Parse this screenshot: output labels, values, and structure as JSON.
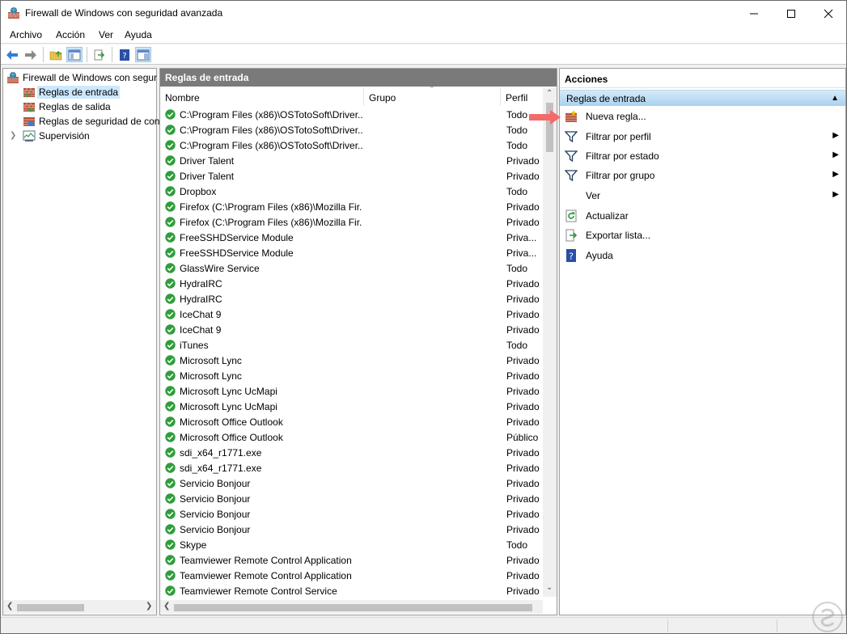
{
  "window": {
    "title": "Firewall de Windows con seguridad avanzada"
  },
  "menu": [
    "Archivo",
    "Acción",
    "Ver",
    "Ayuda"
  ],
  "tree": {
    "root": "Firewall de Windows con segur",
    "items": [
      "Reglas de entrada",
      "Reglas de salida",
      "Reglas de seguridad de con",
      "Supervisión"
    ]
  },
  "center": {
    "header": "Reglas de entrada",
    "columns": {
      "name": "Nombre",
      "group": "Grupo",
      "profile": "Perfil"
    },
    "rows": [
      {
        "name": "C:\\Program Files (x86)\\OSTotoSoft\\Driver...",
        "profile": "Todo"
      },
      {
        "name": "C:\\Program Files (x86)\\OSTotoSoft\\Driver...",
        "profile": "Todo"
      },
      {
        "name": "C:\\Program Files (x86)\\OSTotoSoft\\Driver...",
        "profile": "Todo"
      },
      {
        "name": "Driver Talent",
        "profile": "Privado"
      },
      {
        "name": "Driver Talent",
        "profile": "Privado"
      },
      {
        "name": "Dropbox",
        "profile": "Todo"
      },
      {
        "name": "Firefox (C:\\Program Files (x86)\\Mozilla Fir...",
        "profile": "Privado"
      },
      {
        "name": "Firefox (C:\\Program Files (x86)\\Mozilla Fir...",
        "profile": "Privado"
      },
      {
        "name": "FreeSSHDService Module",
        "profile": "Priva..."
      },
      {
        "name": "FreeSSHDService Module",
        "profile": "Priva..."
      },
      {
        "name": "GlassWire Service",
        "profile": "Todo"
      },
      {
        "name": "HydraIRC",
        "profile": "Privado"
      },
      {
        "name": "HydraIRC",
        "profile": "Privado"
      },
      {
        "name": "IceChat 9",
        "profile": "Privado"
      },
      {
        "name": "IceChat 9",
        "profile": "Privado"
      },
      {
        "name": "iTunes",
        "profile": "Todo"
      },
      {
        "name": "Microsoft Lync",
        "profile": "Privado"
      },
      {
        "name": "Microsoft Lync",
        "profile": "Privado"
      },
      {
        "name": "Microsoft Lync UcMapi",
        "profile": "Privado"
      },
      {
        "name": "Microsoft Lync UcMapi",
        "profile": "Privado"
      },
      {
        "name": "Microsoft Office Outlook",
        "profile": "Privado"
      },
      {
        "name": "Microsoft Office Outlook",
        "profile": "Público"
      },
      {
        "name": "sdi_x64_r1771.exe",
        "profile": "Privado"
      },
      {
        "name": "sdi_x64_r1771.exe",
        "profile": "Privado"
      },
      {
        "name": "Servicio Bonjour",
        "profile": "Privado"
      },
      {
        "name": "Servicio Bonjour",
        "profile": "Privado"
      },
      {
        "name": "Servicio Bonjour",
        "profile": "Privado"
      },
      {
        "name": "Servicio Bonjour",
        "profile": "Privado"
      },
      {
        "name": "Skype",
        "profile": "Todo"
      },
      {
        "name": "Teamviewer Remote Control Application",
        "profile": "Privado"
      },
      {
        "name": "Teamviewer Remote Control Application",
        "profile": "Privado"
      },
      {
        "name": "Teamviewer Remote Control Service",
        "profile": "Privado"
      }
    ]
  },
  "actions": {
    "header": "Acciones",
    "section": "Reglas de entrada",
    "items": [
      {
        "label": "Nueva regla...",
        "icon": "new-rule-icon",
        "submenu": false
      },
      {
        "label": "Filtrar por perfil",
        "icon": "filter-icon",
        "submenu": true
      },
      {
        "label": "Filtrar por estado",
        "icon": "filter-icon",
        "submenu": true
      },
      {
        "label": "Filtrar por grupo",
        "icon": "filter-icon",
        "submenu": true
      },
      {
        "label": "Ver",
        "icon": "",
        "submenu": true
      },
      {
        "label": "Actualizar",
        "icon": "refresh-icon",
        "submenu": false
      },
      {
        "label": "Exportar lista...",
        "icon": "export-icon",
        "submenu": false
      },
      {
        "label": "Ayuda",
        "icon": "help-icon",
        "submenu": false
      }
    ]
  },
  "colors": {
    "selection": "#cce8ff",
    "section_gradient_top": "#d6eaf8",
    "section_gradient_bottom": "#a9d1ef",
    "check_green": "#2e9e3a",
    "pointer_arrow": "#f26b6b"
  }
}
